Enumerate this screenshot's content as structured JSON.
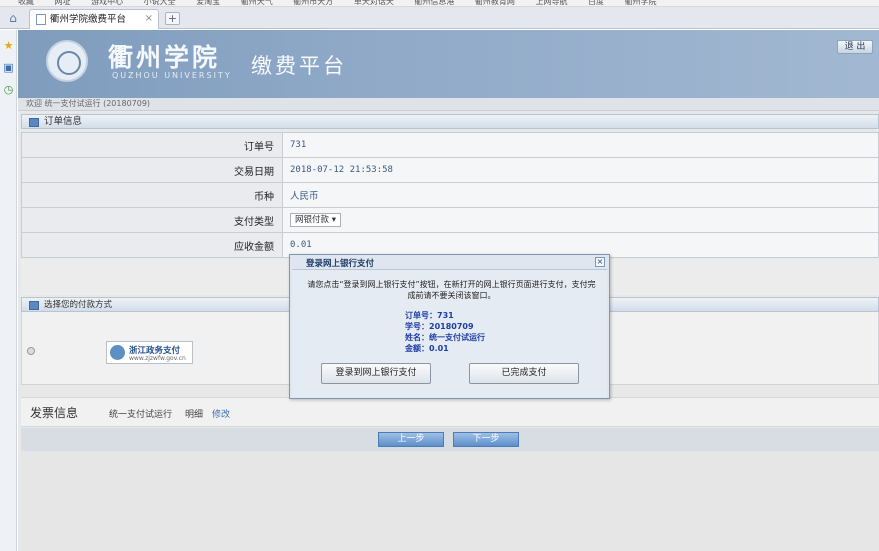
{
  "browser": {
    "bookmarks": [
      "收藏",
      "网址",
      "游戏中心",
      "小说大全",
      "爱淘宝",
      "衢州天气",
      "衢州市天方",
      "单天对话天",
      "衢州信息港",
      "衢州教育网",
      "上网导航",
      "百度",
      "衢州学院"
    ],
    "tab_title": "衢州学院缴费平台",
    "tab_close": "×",
    "new_tab": "+",
    "home_icon": "⌂",
    "side_icons": [
      "★",
      "▣",
      "◷"
    ]
  },
  "header": {
    "school_name": "衢州学院",
    "school_en": "QUZHOU UNIVERSITY",
    "platform_name": "缴费平台",
    "logout_label": "退 出"
  },
  "welcome": "欢迎  统一支付试运行  (20180709)",
  "order_section": {
    "title": "订单信息",
    "rows": [
      {
        "label": "订单号",
        "value": "731"
      },
      {
        "label": "交易日期",
        "value": "2018-07-12 21:53:58"
      },
      {
        "label": "币种",
        "value": "人民币"
      },
      {
        "label": "支付类型",
        "value": "网银付款 ▾"
      },
      {
        "label": "应收金额",
        "value": "0.01"
      }
    ]
  },
  "payment_section": {
    "title": "选择您的付款方式",
    "method_name": "浙江政务支付",
    "method_url": "www.zjzwfw.gov.cn"
  },
  "invoice": {
    "title": "发票信息",
    "name": "统一支付试运行",
    "detail": "明细",
    "edit": "修改"
  },
  "nav": {
    "prev": "上一步",
    "next": "下一步"
  },
  "modal": {
    "title": "登录网上银行支付",
    "close": "×",
    "message": "请您点击“登录到网上银行支付”按钮，在新打开的网上银行页面进行支付，支付完成前请不要关闭该窗口。",
    "info": [
      "订单号：731",
      "学号：20180709",
      "姓名：统一支付试运行",
      "金额：0.01"
    ],
    "login_button": "登录到网上银行支付",
    "done_button": "已完成支付"
  },
  "colors": {
    "header_bg": "#8fa9c7",
    "accent_blue": "#5d8fcb",
    "value_text": "#3d5a85"
  }
}
